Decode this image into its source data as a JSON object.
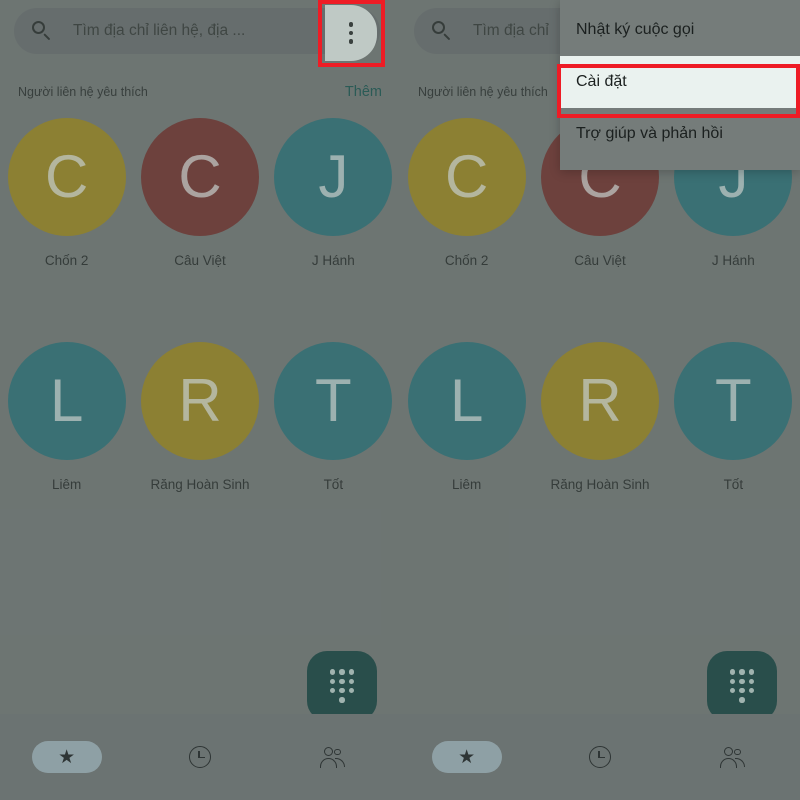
{
  "search": {
    "placeholder_left": "Tìm địa chỉ liên hệ, địa ...",
    "placeholder_right": "Tìm địa chỉ",
    "search_icon": "search-icon",
    "mic_icon": "microphone-icon",
    "overflow_icon": "overflow-menu-icon"
  },
  "section": {
    "title": "Người liên hệ yêu thích",
    "action": "Thêm"
  },
  "favorites": [
    {
      "initial": "C",
      "name": "Chốn 2",
      "color": "#9a8418"
    },
    {
      "initial": "C",
      "name": "Câu Việt",
      "color": "#6e2a26"
    },
    {
      "initial": "J",
      "name": "J Hánh",
      "color": "#256e74"
    },
    {
      "initial": "L",
      "name": "Liêm",
      "color": "#256e74"
    },
    {
      "initial": "R",
      "name": "Răng Hoàn Sinh",
      "color": "#9a8418"
    },
    {
      "initial": "T",
      "name": "Tốt",
      "color": "#256e74"
    }
  ],
  "fab": {
    "name": "dialpad-fab",
    "color": "#0c3d3a"
  },
  "bottom_nav": [
    {
      "icon": "star-icon",
      "label": "favorites",
      "active": true
    },
    {
      "icon": "clock-icon",
      "label": "recents",
      "active": false
    },
    {
      "icon": "people-icon",
      "label": "contacts",
      "active": false
    }
  ],
  "dropdown_menu": {
    "items": [
      {
        "label": "Nhật ký cuộc gọi",
        "highlighted": false
      },
      {
        "label": "Cài đặt",
        "highlighted": true
      },
      {
        "label": "Trợ giúp và phản hồi",
        "highlighted": false
      }
    ]
  },
  "annotations": {
    "color": "#ee1c25",
    "overflow_target": "overflow-menu-button",
    "settings_target": "menu-item-settings"
  }
}
